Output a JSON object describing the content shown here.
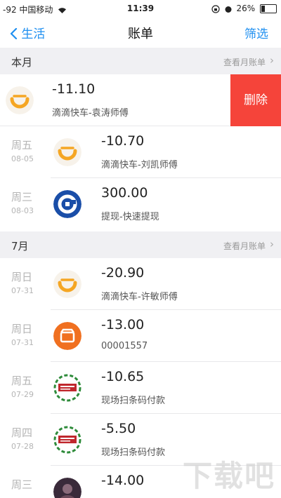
{
  "status_bar": {
    "carrier": "-92 中国移动",
    "time": "11:39",
    "battery_text": "26%",
    "battery_level": 0.26
  },
  "nav": {
    "back_label": "生活",
    "title": "账单",
    "filter_label": "筛选"
  },
  "sections": [
    {
      "title": "本月",
      "link": "查看月账单",
      "rows": [
        {
          "weekday": "",
          "date": "",
          "amount": "-11.10",
          "desc": "滴滴快车-袁涛师傅",
          "icon": "didi-icon",
          "swiped": true,
          "delete_label": "删除"
        },
        {
          "weekday": "周五",
          "date": "08-05",
          "amount": "-10.70",
          "desc": "滴滴快车-刘凯师傅",
          "icon": "didi-icon",
          "swiped": false
        },
        {
          "weekday": "周三",
          "date": "08-03",
          "amount": "300.00",
          "desc": "提现-快速提现",
          "icon": "ccb-icon",
          "swiped": false
        }
      ]
    },
    {
      "title": "7月",
      "link": "查看月账单",
      "rows": [
        {
          "weekday": "周日",
          "date": "07-31",
          "amount": "-20.90",
          "desc": "滴滴快车-许敏师傅",
          "icon": "didi-icon",
          "swiped": false
        },
        {
          "weekday": "周日",
          "date": "07-31",
          "amount": "-13.00",
          "desc": "00001557",
          "icon": "shop-icon",
          "swiped": false
        },
        {
          "weekday": "周五",
          "date": "07-29",
          "amount": "-10.65",
          "desc": "现场扫条码付款",
          "icon": "wudongfeng-icon",
          "swiped": false
        },
        {
          "weekday": "周四",
          "date": "07-28",
          "amount": "-5.50",
          "desc": "现场扫条码付款",
          "icon": "wudongfeng-icon",
          "swiped": false
        },
        {
          "weekday": "周三",
          "date": "",
          "amount": "-14.00",
          "desc": "",
          "icon": "avatar-icon",
          "swiped": false
        }
      ]
    }
  ],
  "watermark": "下载吧",
  "colors": {
    "accent": "#1e8ff0",
    "delete": "#f5443a",
    "didi": "#f5a623",
    "ccb": "#1a4ea8",
    "shop": "#f07020",
    "wudongfeng": "#c0282e"
  }
}
